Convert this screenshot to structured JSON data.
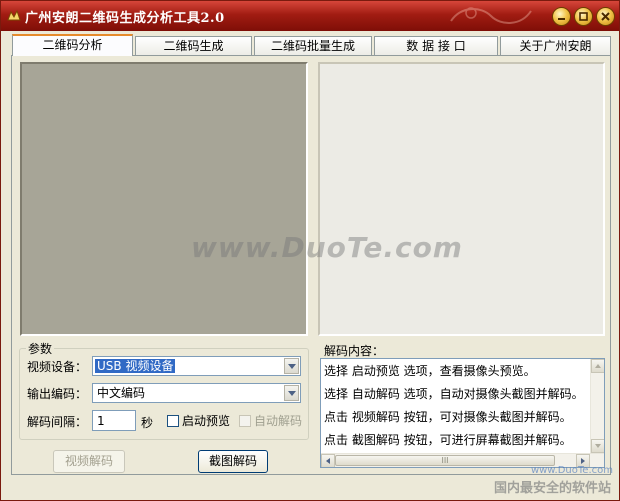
{
  "window": {
    "title": "广州安朗二维码生成分析工具2.0"
  },
  "tabs": [
    {
      "label": "二维码分析",
      "active": true
    },
    {
      "label": "二维码生成"
    },
    {
      "label": "二维码批量生成"
    },
    {
      "label": "数 据 接 口"
    },
    {
      "label": "关于广州安朗"
    }
  ],
  "params": {
    "legend": "参数",
    "device_label": "视频设备：",
    "device_value": "USB 视频设备",
    "encoding_label": "输出编码：",
    "encoding_value": "中文编码",
    "interval_label": "解码间隔：",
    "interval_value": "1",
    "interval_unit": "秒",
    "preview_check_label": "启动预览",
    "auto_decode_label": "自动解码"
  },
  "buttons": {
    "video_decode": "视频解码",
    "screenshot_decode": "截图解码"
  },
  "result": {
    "label": "解码内容：",
    "lines": [
      "选择 启动预览 选项，查看摄像头预览。",
      "选择 自动解码 选项，自动对摄像头截图并解码。",
      "点击 视频解码 按钮，可对摄像头截图并解码。",
      "点击 截图解码 按钮，可进行屏幕截图并解码。"
    ],
    "hscroll_grip": "III"
  },
  "watermark": {
    "text": "www.DuoTe.com",
    "corner": "www.DuoTe.com",
    "corner_big": "国内最安全的软件站"
  },
  "colors": {
    "titlebar": "#a11c12",
    "video_bg": "#a7a597",
    "selection": "#316ac5"
  }
}
